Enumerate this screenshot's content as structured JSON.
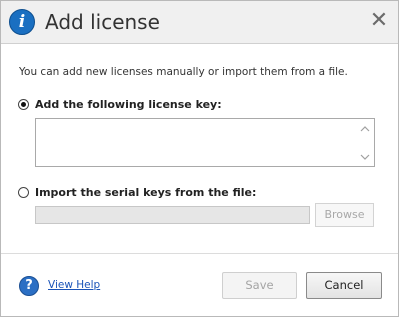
{
  "dialog": {
    "title": "Add license",
    "close_symbol": "✕",
    "title_icon_glyph": "i",
    "title_icon": "info-icon"
  },
  "intro_text": "You can add new licenses manually or import them from a file.",
  "options": {
    "manual": {
      "label": "Add the following license key:",
      "selected": true,
      "value": ""
    },
    "file": {
      "label": "Import the serial keys from the file:",
      "selected": false,
      "value": ""
    }
  },
  "buttons": {
    "browse": "Browse",
    "save": "Save",
    "cancel": "Cancel"
  },
  "help": {
    "icon_glyph": "?",
    "label": "View Help"
  },
  "colors": {
    "accent": "#1a6fc1",
    "link": "#1a53b8",
    "disabled_text": "#a8a8a8"
  }
}
